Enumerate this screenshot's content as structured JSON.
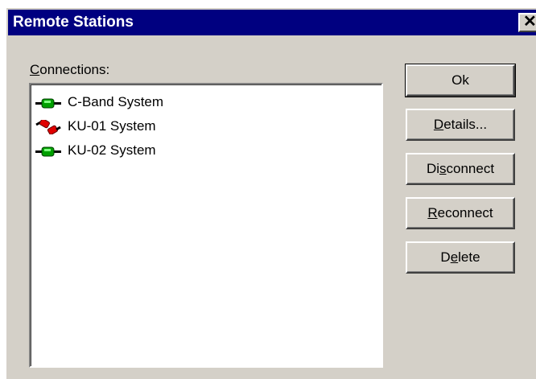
{
  "window": {
    "title": "Remote Stations",
    "close_label": "✕"
  },
  "connections": {
    "label_prefix": "",
    "label_accel": "C",
    "label_rest": "onnections:",
    "items": [
      {
        "label": "C-Band System",
        "status": "connected",
        "icon": "connected-plug-icon"
      },
      {
        "label": "KU-01 System",
        "status": "disconnected",
        "icon": "disconnected-plug-icon"
      },
      {
        "label": "KU-02 System",
        "status": "connected",
        "icon": "connected-plug-icon"
      }
    ]
  },
  "buttons": {
    "ok": {
      "pre": "Ok",
      "accel": "",
      "post": ""
    },
    "details": {
      "pre": "",
      "accel": "D",
      "post": "etails..."
    },
    "disconnect": {
      "pre": "Di",
      "accel": "s",
      "post": "connect"
    },
    "reconnect": {
      "pre": "",
      "accel": "R",
      "post": "econnect"
    },
    "delete": {
      "pre": "D",
      "accel": "e",
      "post": "lete"
    }
  },
  "colors": {
    "titlebar": "#000080",
    "face": "#d4d0c8",
    "connected": "#00a000",
    "disconnected": "#e00000"
  }
}
